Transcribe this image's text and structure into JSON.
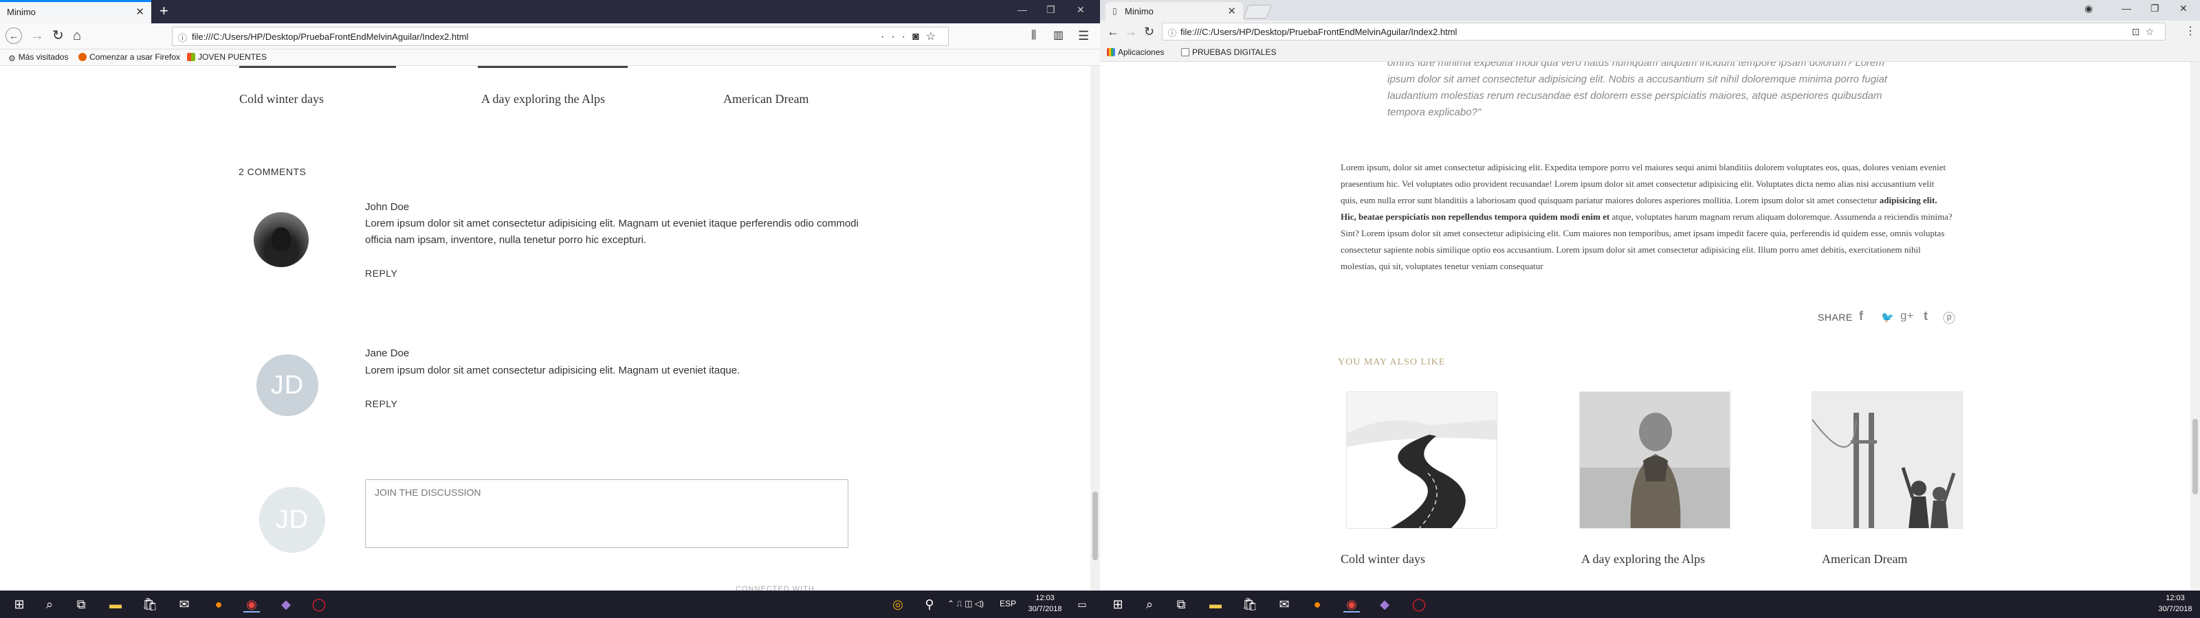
{
  "left_window": {
    "tab_title": "Minimo",
    "url": "file:///C:/Users/HP/Desktop/PruebaFrontEndMelvinAguilar/Index2.html",
    "bookmarks": [
      "Más visitados",
      "Comenzar a usar Firefox",
      "JOVEN PUENTES"
    ],
    "related_posts": [
      "Cold winter days",
      "A day exploring the Alps",
      "American Dream"
    ],
    "comments_count_label": "2 COMMENTS",
    "comments": [
      {
        "author": "John Doe",
        "text": "Lorem ipsum dolor sit amet consectetur adipisicing elit. Magnam ut eveniet itaque perferendis odio commodi officia nam ipsam, inventore, nulla tenetur porro hic excepturi.",
        "reply_label": "REPLY",
        "avatar_initials": ""
      },
      {
        "author": "Jane Doe",
        "text": "Lorem ipsum dolor sit amet consectetur adipisicing elit. Magnam ut eveniet itaque.",
        "reply_label": "REPLY",
        "avatar_initials": "JD"
      }
    ],
    "join": {
      "avatar_initials": "JD",
      "placeholder": "JOIN THE DISCUSSION",
      "connected_label": "CONNECTED WITH"
    }
  },
  "right_window": {
    "tab_title": "Minimo",
    "url": "file:///C:/Users/HP/Desktop/PruebaFrontEndMelvinAguilar/Index2.html",
    "bookmarks": [
      "Aplicaciones",
      "PRUEBAS DIGITALES"
    ],
    "quote": "omnis iure minima expedita modi qua vero natus numquam aliquam incidunt tempore ipsam dolorum? Lorem ipsum dolor sit amet consectetur adipisicing elit. Nobis a accusantium sit nihil doloremque minima porro fugiat laudantium molestias rerum recusandae est dolorem esse perspiciatis maiores, atque asperiores quibusdam tempora explicabo?\"",
    "body_before_bold": "Lorem ipsum, dolor sit amet consectetur adipisicing elit. Expedita tempore porro vel maiores sequi animi blanditiis dolorem voluptates eos, quas, dolores veniam eveniet praesentium hic. Vel voluptates odio provident recusandae! Lorem ipsum dolor sit amet consectetur adipisicing elit. Voluptates dicta nemo alias nisi accusantium velit quis, eum nulla error sunt blanditiis a laboriosam quod quisquam pariatur maiores dolores asperiores mollitia. Lorem ipsum dolor sit amet consectetur",
    "body_bold": "adipisicing elit. Hic, beatae perspiciatis non repellendus tempora quidem modi enim et",
    "body_after_bold": "atque, voluptates harum magnam rerum aliquam doloremque. Assumenda a reiciendis minima? Sint? Lorem ipsum dolor sit amet consectetur adipisicing elit. Cum maiores non temporibus, amet ipsam impedit facere quia, perferendis id quidem esse, omnis voluptas consectetur sapiente nobis similique optio eos accusantium. Lorem ipsum dolor sit amet consectetur adipisicing elit. Illum porro amet debitis, exercitationem nihil molestias, qui sit, voluptates tenetur veniam consequatur",
    "share_label": "SHARE",
    "you_may_also_like": "YOU MAY ALSO LIKE",
    "related_posts": [
      "Cold winter days",
      "A day exploring the Alps",
      "American Dream"
    ]
  },
  "taskbar_left": {
    "lang": "ESP",
    "time": "12:03",
    "date": "30/7/2018"
  },
  "taskbar_right": {
    "time": "12:03",
    "date": "30/7/2018"
  },
  "colors": {
    "firefox_accent": "#0a84ff",
    "you_may_also_like": "#b5a67a",
    "avatar_jd": "#c9d3d9"
  }
}
